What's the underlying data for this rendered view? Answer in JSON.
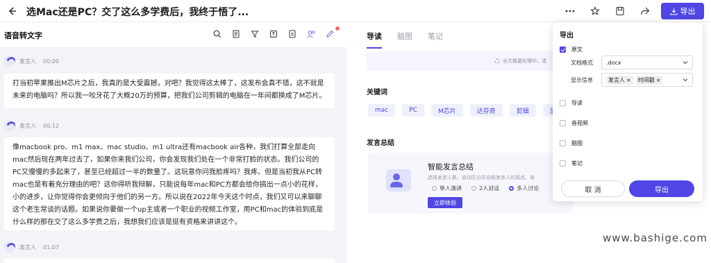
{
  "header": {
    "title": "选Mac还是PC？交了这么多学费后，我终于悟了...",
    "export_label": "导出"
  },
  "left": {
    "title": "语音转文字",
    "segments": [
      {
        "speaker": "发言人",
        "time": "00:00",
        "text": "打当初苹果推出M芯片之后，我真的是大受震撼，对吧？我觉得这太棒了，这发布会真不错，这不就是未来的电脑吗？所以我一咬牙花了大概20万的预算，把我们公司剪辑的电脑在一年间都换成了M芯片。"
      },
      {
        "speaker": "发言人",
        "time": "00:12",
        "text": "像macbook pro、m1 max、mac studio、m1 ultra还有macbook air各种，我们打算全部走向mac然后现在两年过去了，如果你来我们公司，你会发现我们处在一个非常打脸的状态。我们公司的PC又慢慢的多起来了，甚至已经超过一半的数量了。这玩意你问我脸疼吗？我疼。但是当初我从PC转mac也是有着充分理由的吧？这你得听我辩解，只能说每年mac和PC方都会给你搞出一点小的花样，小的进步，让你觉得你会更倾向于他们的另一方。所以说在2022年今天这个时点，我们又可以来聊聊这个老生常谈的话题。如果说你要做一个up主或者一个职业的视频工作室，用PC和mac的体验到底是什么样的那在交了这么多学费之后，我想我们应该是挺有资格来讲讲这个。"
      },
      {
        "speaker": "发言人",
        "time": "01:07"
      }
    ]
  },
  "right": {
    "tabs": [
      "导读",
      "脑图",
      "笔记"
    ],
    "summary_status": "全文概要处理中，请",
    "keywords_title": "关键词",
    "keywords": [
      "mac",
      "PC",
      "M芯片",
      "达芬奇",
      "剪辑",
      "显"
    ],
    "speech_summary_title": "发言总结",
    "smart_summary": {
      "title": "智能发言总结",
      "desc": "选择发言人数，自动区分并总结发言人的观点。单",
      "options": [
        "单人演讲",
        "2人对话",
        "多人讨论"
      ],
      "selected": "多人讨论",
      "try_label": "立即体验"
    }
  },
  "export_panel": {
    "title": "导出",
    "original_label": "原文",
    "format_label": "文档格式",
    "format_value": ".docx",
    "info_label": "显示信息",
    "info_chips": [
      "发言人",
      "时间戳"
    ],
    "options": [
      {
        "label": "导读",
        "checked": false
      },
      {
        "label": "音视频",
        "checked": false
      },
      {
        "label": "脑图",
        "checked": false
      },
      {
        "label": "笔记",
        "checked": false
      }
    ],
    "cancel_label": "取 消",
    "export_label": "导出"
  },
  "watermark": "www.bashige.com",
  "colors": {
    "accent": "#4f46e5",
    "panel_bg": "#f3f4f8"
  }
}
